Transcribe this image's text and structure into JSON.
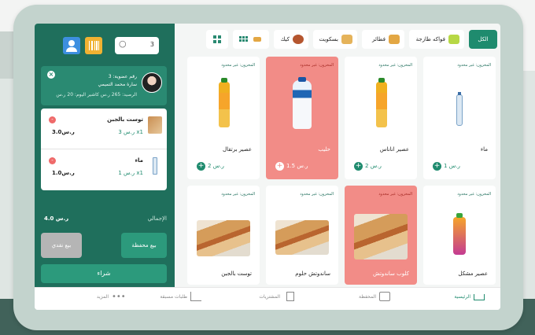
{
  "search": {
    "value": "3"
  },
  "customer": {
    "line1": "رقم عضوية: 3",
    "name": "سارة محمد التميمي",
    "line3": "الرصيد: 265 ر.س   كاشير اليوم: 20 ر.س"
  },
  "cart": {
    "items": [
      {
        "name": "توست بالجبن",
        "qty": "3 ر.س x1",
        "total": "3.0ر.س"
      },
      {
        "name": "ماء",
        "qty": "1 ر.س x1",
        "total": "1.0ر.س"
      }
    ],
    "total_label": "الإجمالي",
    "total_value": "4.0 ر.س",
    "save_label": "بيع محفظة",
    "cash_label": "بيع نقدي",
    "buy_label": "شراء"
  },
  "categories": [
    {
      "label": "الكل"
    },
    {
      "label": "فواكه طازجة"
    },
    {
      "label": "فطائر"
    },
    {
      "label": "بسكويت"
    },
    {
      "label": "كيك"
    }
  ],
  "stock_label": "المخزون: غير محدود",
  "products": [
    {
      "name": "ماء",
      "price": "1 ر.س"
    },
    {
      "name": "عصير اناناس",
      "price": "2 ر.س"
    },
    {
      "name": "حليب",
      "price": "1.5 ر.س"
    },
    {
      "name": "عصير برتقال",
      "price": "2 ر.س"
    },
    {
      "name": "عصير مشكل",
      "price": ""
    },
    {
      "name": "كلوب ساندوتش",
      "price": ""
    },
    {
      "name": "ساندوتش حلوم",
      "price": ""
    },
    {
      "name": "توست بالجبن",
      "price": ""
    }
  ],
  "nav": {
    "home": "الرئيسية",
    "wallet": "المحفظة",
    "purchases": "المشتريات",
    "orders": "طلبات مسبقة",
    "more": "المزيد"
  },
  "colors": {
    "primary": "#1f6f5c",
    "accent": "#2c9a7c",
    "selected": "#f28c87"
  }
}
